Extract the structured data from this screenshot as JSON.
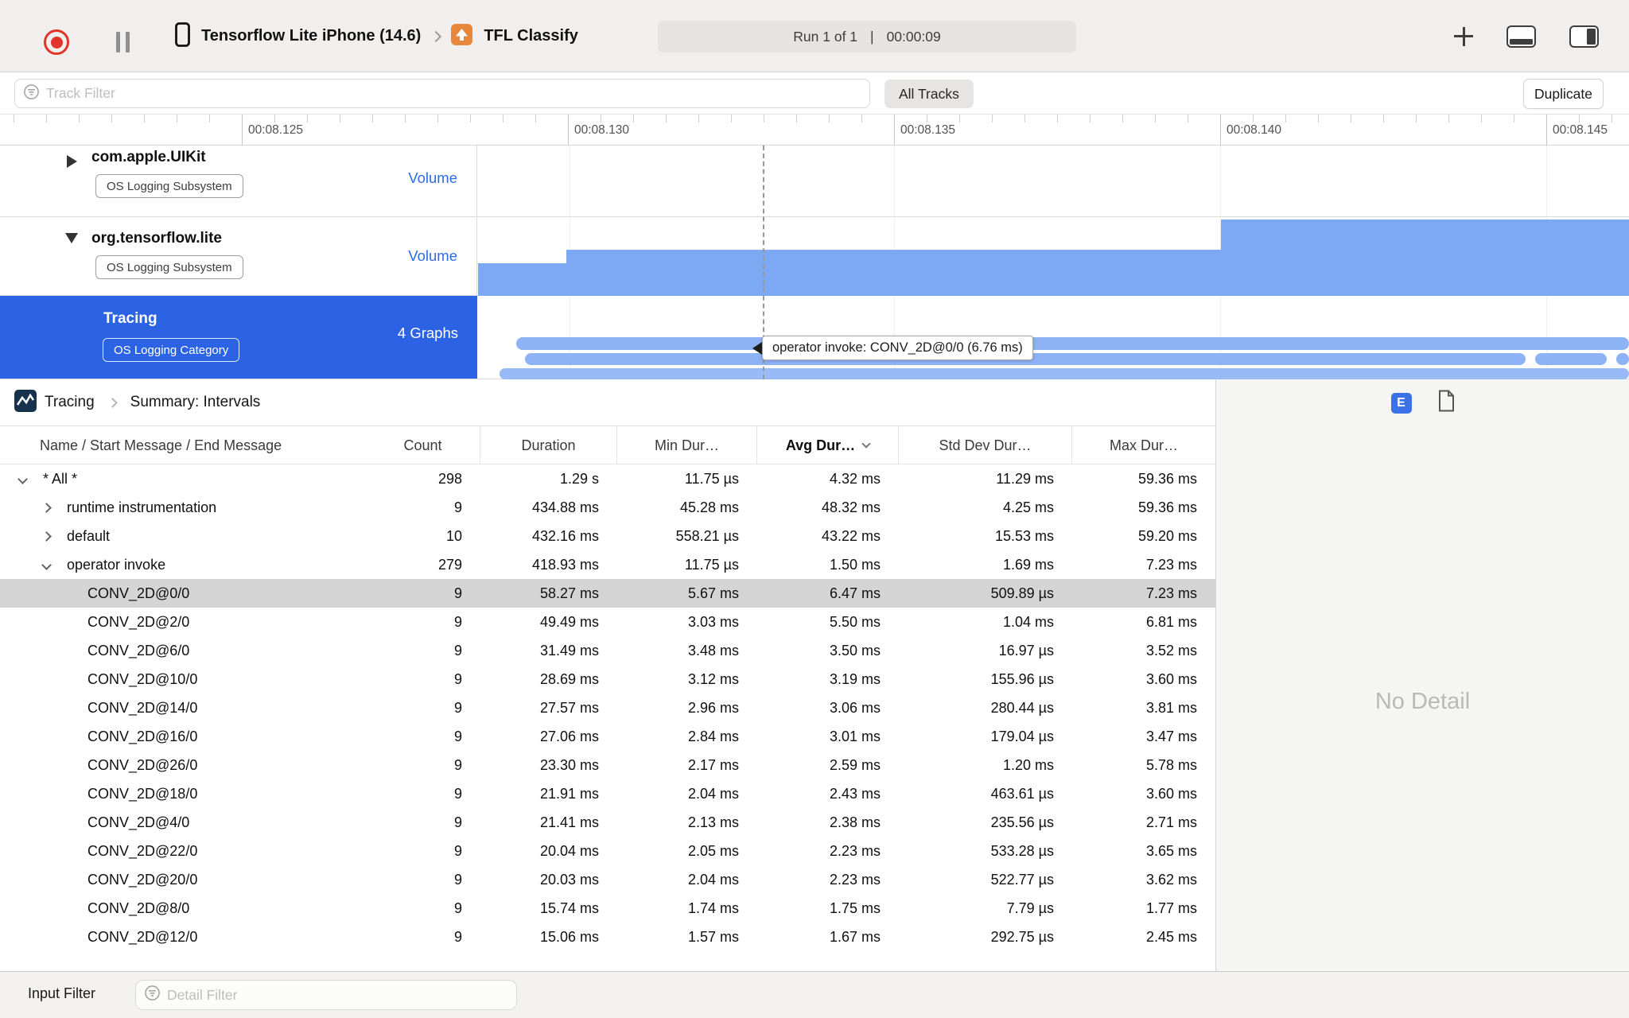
{
  "toolbar": {
    "device_name": "Tensorflow Lite iPhone (14.6)",
    "app_name": "TFL Classify",
    "run_label": "Run 1 of 1",
    "separator": "|",
    "elapsed_time": "00:00:09"
  },
  "filter_bar": {
    "track_filter_placeholder": "Track Filter",
    "all_tracks": "All Tracks",
    "duplicate": "Duplicate"
  },
  "ruler": {
    "labels": [
      "00:08.125",
      "00:08.130",
      "00:08.135",
      "00:08.140",
      "00:08.145"
    ]
  },
  "tracks": [
    {
      "name": "com.apple.UIKit",
      "badge": "OS Logging Subsystem",
      "meta": "Volume",
      "expanded": false,
      "selected": false
    },
    {
      "name": "org.tensorflow.lite",
      "badge": "OS Logging Subsystem",
      "meta": "Volume",
      "expanded": true,
      "selected": false
    },
    {
      "name": "Tracing",
      "badge": "OS Logging Category",
      "meta": "4 Graphs",
      "expanded": false,
      "selected": true
    }
  ],
  "timeline": {
    "tooltip": "operator invoke: CONV_2D@0/0 (6.76 ms)"
  },
  "detail_panel": {
    "breadcrumb_root": "Tracing",
    "breadcrumb_page": "Summary: Intervals",
    "e_badge": "E",
    "no_detail": "No Detail"
  },
  "table": {
    "columns": [
      "Name / Start Message / End Message",
      "Count",
      "Duration",
      "Min Dur…",
      "Avg Dur…",
      "Std Dev Dur…",
      "Max Dur…"
    ],
    "rows": [
      {
        "name": "* All *",
        "level": 0,
        "disclosure": "down",
        "selected": false,
        "count": "298",
        "duration": "1.29 s",
        "min": "11.75 µs",
        "avg": "4.32 ms",
        "std": "11.29 ms",
        "max": "59.36 ms"
      },
      {
        "name": "runtime instrumentation",
        "level": 1,
        "disclosure": "right",
        "selected": false,
        "count": "9",
        "duration": "434.88 ms",
        "min": "45.28 ms",
        "avg": "48.32 ms",
        "std": "4.25 ms",
        "max": "59.36 ms"
      },
      {
        "name": "default",
        "level": 1,
        "disclosure": "right",
        "selected": false,
        "count": "10",
        "duration": "432.16 ms",
        "min": "558.21 µs",
        "avg": "43.22 ms",
        "std": "15.53 ms",
        "max": "59.20 ms"
      },
      {
        "name": "operator invoke",
        "level": 1,
        "disclosure": "down",
        "selected": false,
        "count": "279",
        "duration": "418.93 ms",
        "min": "11.75 µs",
        "avg": "1.50 ms",
        "std": "1.69 ms",
        "max": "7.23 ms"
      },
      {
        "name": "CONV_2D@0/0",
        "level": 2,
        "disclosure": "none",
        "selected": true,
        "count": "9",
        "duration": "58.27 ms",
        "min": "5.67 ms",
        "avg": "6.47 ms",
        "std": "509.89 µs",
        "max": "7.23 ms"
      },
      {
        "name": "CONV_2D@2/0",
        "level": 2,
        "disclosure": "none",
        "selected": false,
        "count": "9",
        "duration": "49.49 ms",
        "min": "3.03 ms",
        "avg": "5.50 ms",
        "std": "1.04 ms",
        "max": "6.81 ms"
      },
      {
        "name": "CONV_2D@6/0",
        "level": 2,
        "disclosure": "none",
        "selected": false,
        "count": "9",
        "duration": "31.49 ms",
        "min": "3.48 ms",
        "avg": "3.50 ms",
        "std": "16.97 µs",
        "max": "3.52 ms"
      },
      {
        "name": "CONV_2D@10/0",
        "level": 2,
        "disclosure": "none",
        "selected": false,
        "count": "9",
        "duration": "28.69 ms",
        "min": "3.12 ms",
        "avg": "3.19 ms",
        "std": "155.96 µs",
        "max": "3.60 ms"
      },
      {
        "name": "CONV_2D@14/0",
        "level": 2,
        "disclosure": "none",
        "selected": false,
        "count": "9",
        "duration": "27.57 ms",
        "min": "2.96 ms",
        "avg": "3.06 ms",
        "std": "280.44 µs",
        "max": "3.81 ms"
      },
      {
        "name": "CONV_2D@16/0",
        "level": 2,
        "disclosure": "none",
        "selected": false,
        "count": "9",
        "duration": "27.06 ms",
        "min": "2.84 ms",
        "avg": "3.01 ms",
        "std": "179.04 µs",
        "max": "3.47 ms"
      },
      {
        "name": "CONV_2D@26/0",
        "level": 2,
        "disclosure": "none",
        "selected": false,
        "count": "9",
        "duration": "23.30 ms",
        "min": "2.17 ms",
        "avg": "2.59 ms",
        "std": "1.20 ms",
        "max": "5.78 ms"
      },
      {
        "name": "CONV_2D@18/0",
        "level": 2,
        "disclosure": "none",
        "selected": false,
        "count": "9",
        "duration": "21.91 ms",
        "min": "2.04 ms",
        "avg": "2.43 ms",
        "std": "463.61 µs",
        "max": "3.60 ms"
      },
      {
        "name": "CONV_2D@4/0",
        "level": 2,
        "disclosure": "none",
        "selected": false,
        "count": "9",
        "duration": "21.41 ms",
        "min": "2.13 ms",
        "avg": "2.38 ms",
        "std": "235.56 µs",
        "max": "2.71 ms"
      },
      {
        "name": "CONV_2D@22/0",
        "level": 2,
        "disclosure": "none",
        "selected": false,
        "count": "9",
        "duration": "20.04 ms",
        "min": "2.05 ms",
        "avg": "2.23 ms",
        "std": "533.28 µs",
        "max": "3.65 ms"
      },
      {
        "name": "CONV_2D@20/0",
        "level": 2,
        "disclosure": "none",
        "selected": false,
        "count": "9",
        "duration": "20.03 ms",
        "min": "2.04 ms",
        "avg": "2.23 ms",
        "std": "522.77 µs",
        "max": "3.62 ms"
      },
      {
        "name": "CONV_2D@8/0",
        "level": 2,
        "disclosure": "none",
        "selected": false,
        "count": "9",
        "duration": "15.74 ms",
        "min": "1.74 ms",
        "avg": "1.75 ms",
        "std": "7.79 µs",
        "max": "1.77 ms"
      },
      {
        "name": "CONV_2D@12/0",
        "level": 2,
        "disclosure": "none",
        "selected": false,
        "count": "9",
        "duration": "15.06 ms",
        "min": "1.57 ms",
        "avg": "1.67 ms",
        "std": "292.75 µs",
        "max": "2.45 ms"
      }
    ]
  },
  "bottom_bar": {
    "input_filter": "Input Filter",
    "detail_filter_placeholder": "Detail Filter"
  },
  "colors": {
    "selection_blue": "#2c63e4",
    "chart_blue": "#7da8f3",
    "capsule_blue": "#8db2f6",
    "volume_label_blue": "#2e6be2",
    "selected_row_gray": "#d4d4d4"
  }
}
